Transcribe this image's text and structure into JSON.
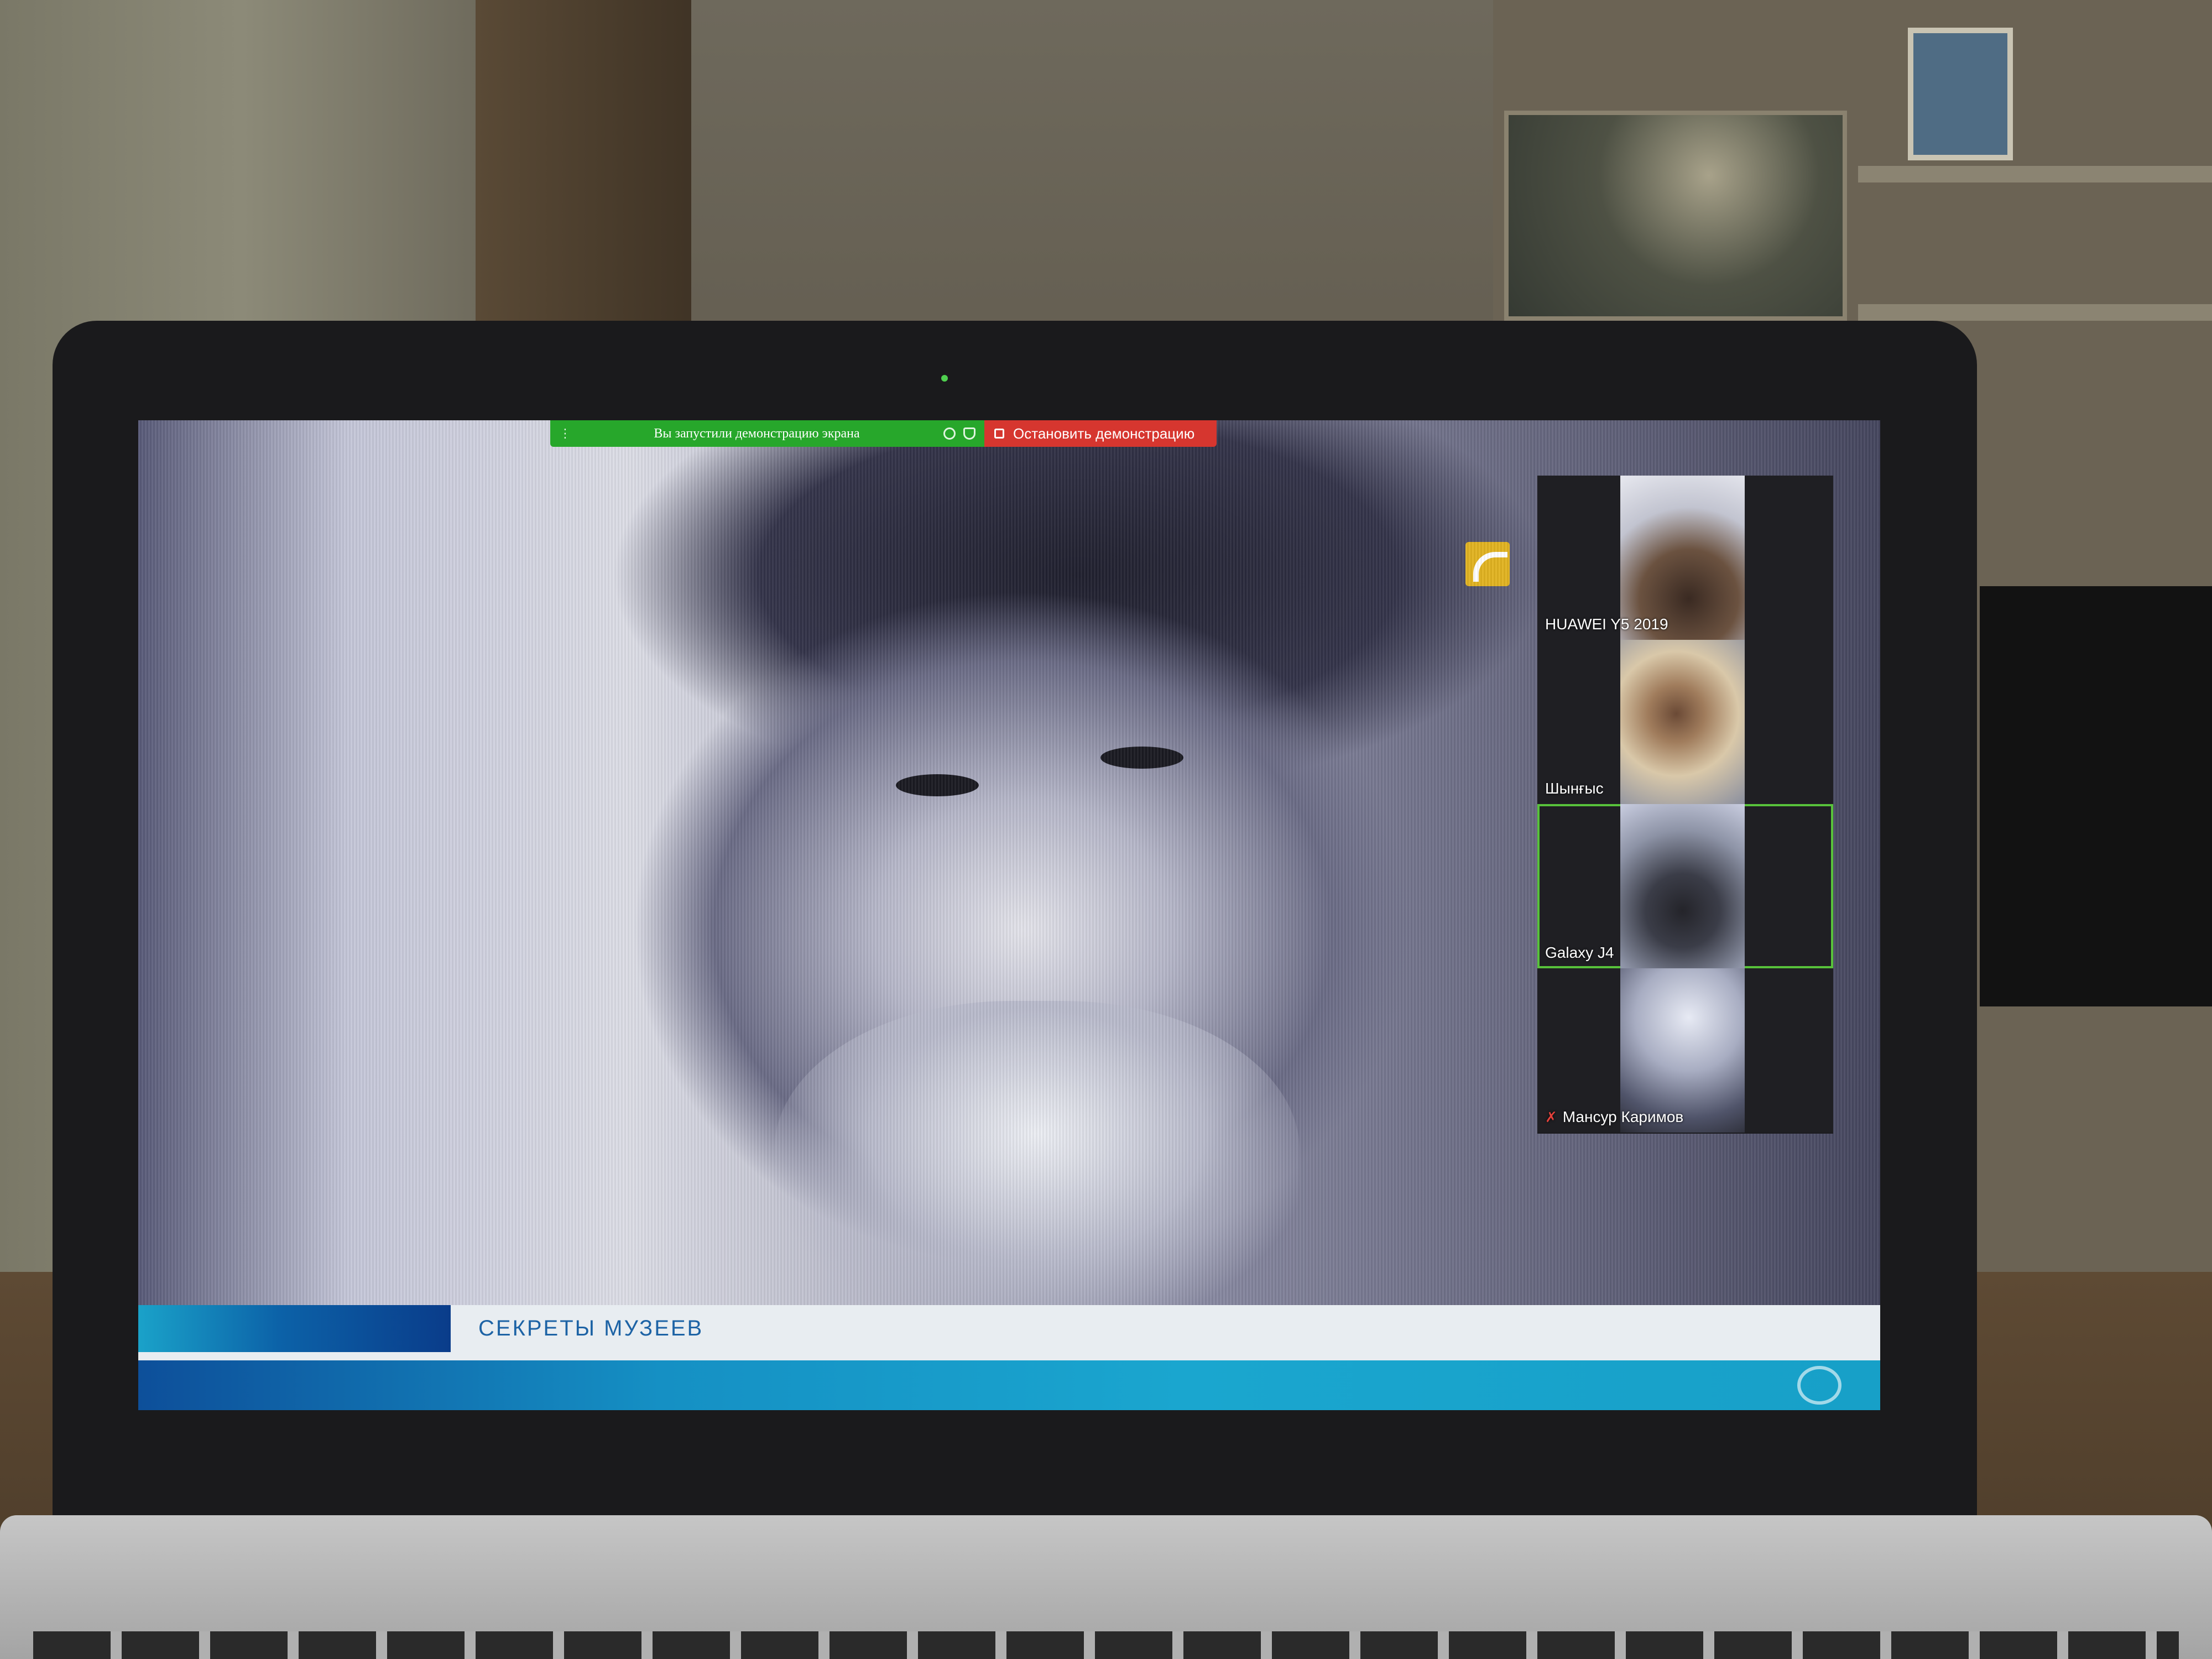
{
  "zoom_share_bar": {
    "status_message": "Вы запустили демонстрацию экрана",
    "stop_label": "Остановить демонстрацию",
    "status_color": "#27a72b",
    "stop_color": "#d6362f",
    "icons": [
      "drag-grip-icon",
      "record-icon",
      "shield-icon",
      "stop-square-icon"
    ]
  },
  "video": {
    "lower_third_title": "СЕКРЕТЫ МУЗЕЕВ",
    "accent_color": "#1aa6cf",
    "channel_logo_color": "#e2b321"
  },
  "gallery": {
    "participants": [
      {
        "name": "HUAWEI Y5 2019",
        "muted": false,
        "active": false
      },
      {
        "name": "Шынғыс",
        "muted": false,
        "active": false
      },
      {
        "name": "Galaxy J4",
        "muted": false,
        "active": true
      },
      {
        "name": "Мансур Каримов",
        "muted": true,
        "active": false
      }
    ],
    "active_border_color": "#58c23b"
  }
}
